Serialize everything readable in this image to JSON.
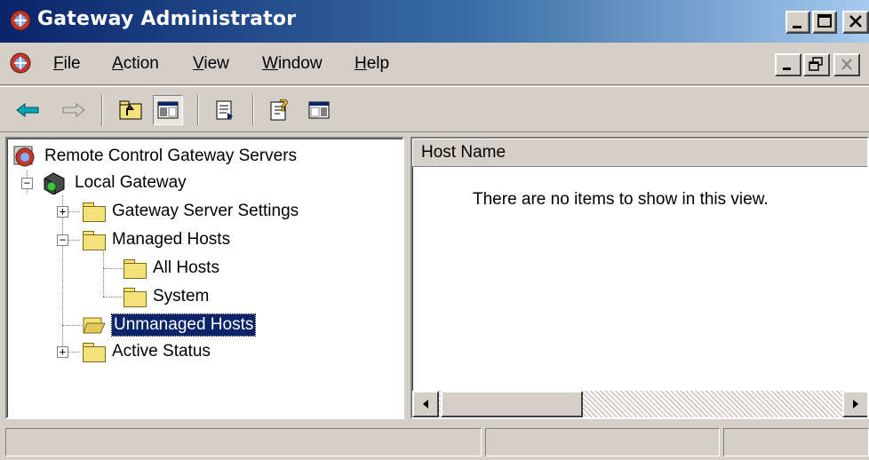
{
  "window": {
    "title": "Gateway Administrator"
  },
  "menu": {
    "items": [
      {
        "label": "File",
        "accel": "F",
        "rest": "ile"
      },
      {
        "label": "Action",
        "accel": "A",
        "rest": "ction"
      },
      {
        "label": "View",
        "accel": "V",
        "rest": "iew"
      },
      {
        "label": "Window",
        "accel": "W",
        "rest": "indow"
      },
      {
        "label": "Help",
        "accel": "H",
        "rest": "elp"
      }
    ]
  },
  "toolbar": {
    "buttons": [
      "back-icon",
      "forward-icon",
      "up-one-level-icon",
      "show-hide-console-tree-icon",
      "export-list-icon",
      "help-icon",
      "show-hide-action-pane-icon"
    ]
  },
  "tree": {
    "root": "Remote Control Gateway Servers",
    "local_gateway": "Local Gateway",
    "gateway_server_settings": "Gateway Server Settings",
    "managed_hosts": "Managed Hosts",
    "all_hosts": "All Hosts",
    "system": "System",
    "unmanaged_hosts": "Unmanaged Hosts",
    "active_status": "Active Status",
    "selected": "Unmanaged Hosts"
  },
  "list": {
    "column_host_name": "Host Name",
    "empty_message": "There are no items to show in this view."
  },
  "colors": {
    "title_gradient_start": "#0a246a",
    "title_gradient_end": "#a6caf0",
    "selection": "#0a246a",
    "face": "#d4d0c8"
  }
}
